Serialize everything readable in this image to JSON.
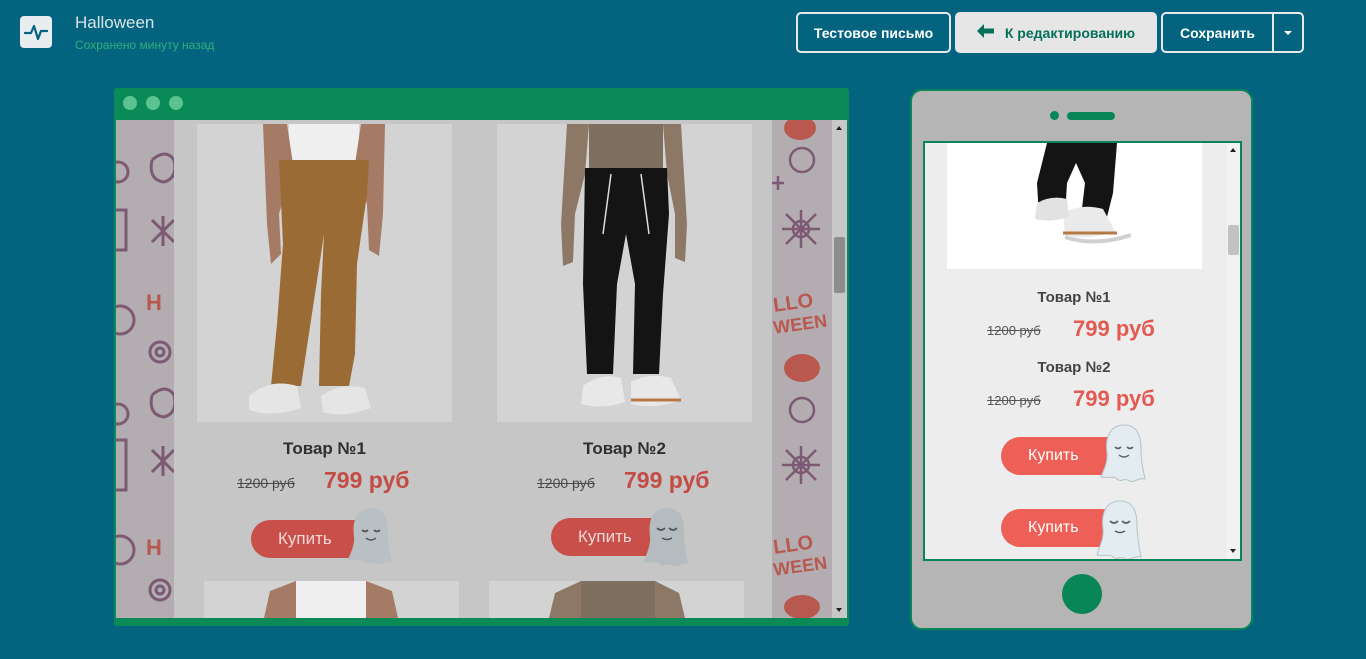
{
  "header": {
    "title": "Halloween",
    "status": "Сохранено минуту назад",
    "test_email_label": "Тестовое письмо",
    "back_to_edit_label": "К редактированию",
    "save_label": "Сохранить"
  },
  "desktop_preview": {
    "products": [
      {
        "name": "Товар №1",
        "old_price": "1200 руб",
        "new_price": "799 руб",
        "buy_label": "Купить"
      },
      {
        "name": "Товар №2",
        "old_price": "1200 руб",
        "new_price": "799 руб",
        "buy_label": "Купить"
      }
    ]
  },
  "mobile_preview": {
    "products": [
      {
        "name": "Товар №1",
        "old_price": "1200 руб",
        "new_price": "799 руб"
      },
      {
        "name": "Товар №2",
        "old_price": "1200 руб",
        "new_price": "799 руб"
      }
    ],
    "buy_labels": [
      "Купить",
      "Купить"
    ]
  },
  "colors": {
    "background": "#04647f",
    "accent_green": "#098658",
    "price_red": "#e35a52"
  },
  "icons": [
    "pulse-logo-icon",
    "arrow-left-icon",
    "caret-down-icon",
    "ghost-icon"
  ]
}
